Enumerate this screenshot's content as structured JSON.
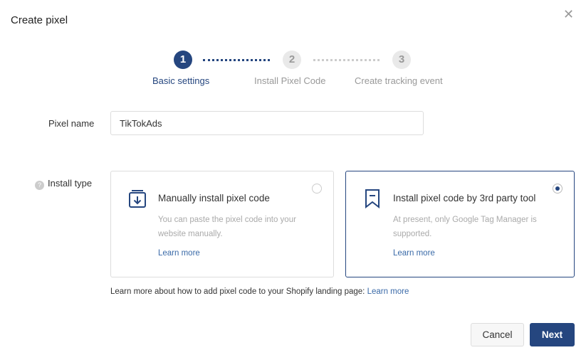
{
  "dialog": {
    "title": "Create pixel",
    "close_icon": "close-icon"
  },
  "steps": [
    {
      "number": "1",
      "label": "Basic settings",
      "active": true
    },
    {
      "number": "2",
      "label": "Install Pixel Code",
      "active": false
    },
    {
      "number": "3",
      "label": "Create tracking event",
      "active": false
    }
  ],
  "form": {
    "pixel_name_label": "Pixel name",
    "pixel_name_value": "TikTokAds",
    "install_type_label": "Install type"
  },
  "options": [
    {
      "title": "Manually install pixel code",
      "description": "You can paste the pixel code into your website manually.",
      "link": "Learn more",
      "selected": false,
      "icon": "download-box-icon"
    },
    {
      "title": "Install pixel code by 3rd party tool",
      "description": "At present, only Google Tag Manager is supported.",
      "link": "Learn more",
      "selected": true,
      "icon": "bookmark-icon"
    }
  ],
  "note": {
    "text": "Learn more about how to add pixel code to your Shopify landing page: ",
    "link": "Learn more"
  },
  "buttons": {
    "cancel": "Cancel",
    "next": "Next"
  },
  "colors": {
    "accent": "#25467f",
    "link": "#3a6aa8"
  }
}
